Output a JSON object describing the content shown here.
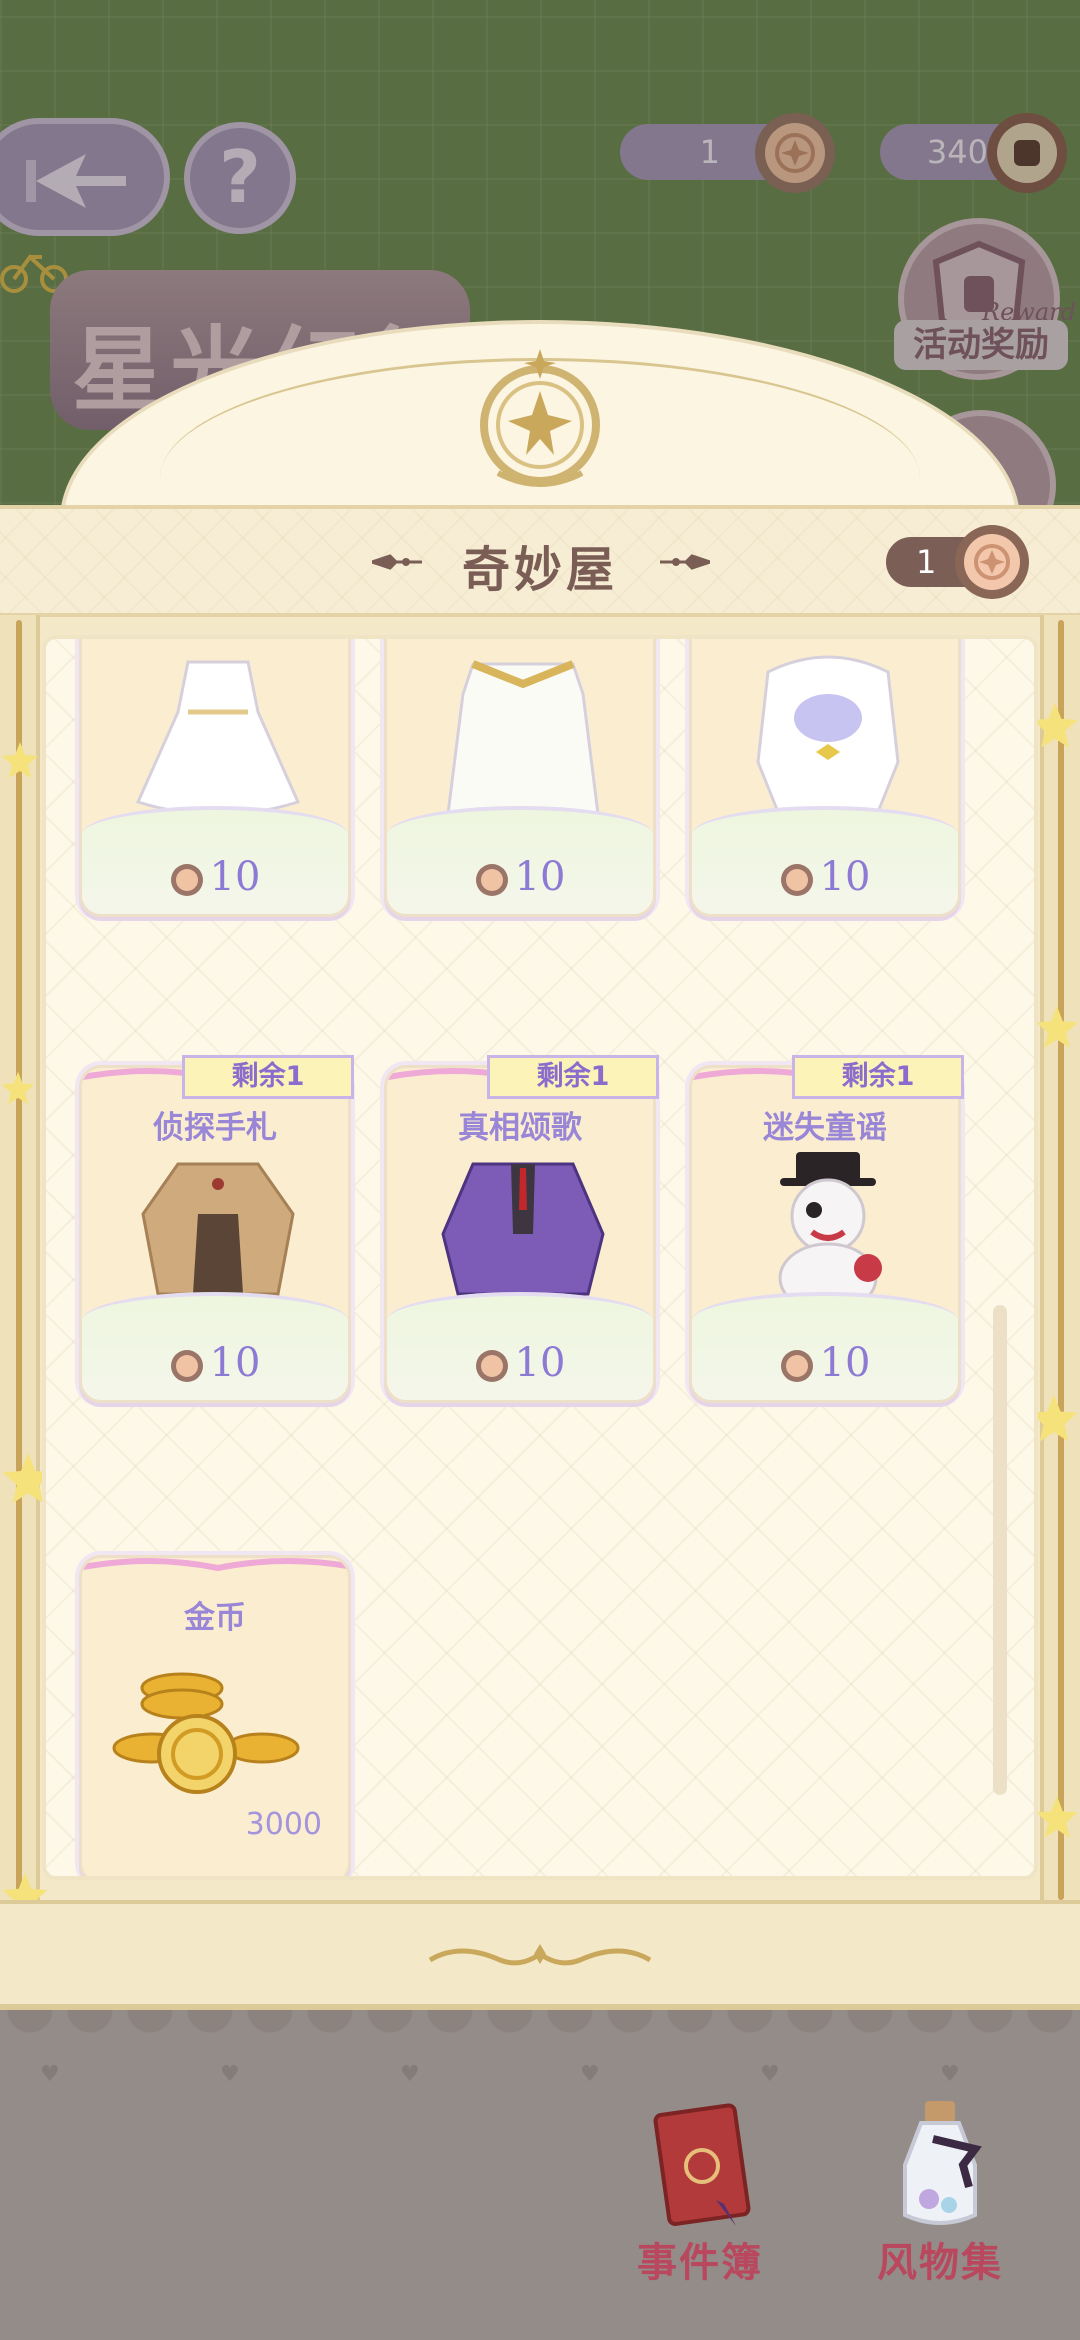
{
  "header": {
    "currency_event": {
      "value": "1",
      "icon": "event-token-coin-icon"
    },
    "currency_badge": {
      "value": "340",
      "icon": "badge-medal-icon"
    },
    "help_glyph": "?",
    "event_title": "星光幻行",
    "reward_button": {
      "label": "活动奖励",
      "script": "Reward"
    }
  },
  "shop": {
    "title": "奇妙屋",
    "balance": "1",
    "items": [
      {
        "name": "",
        "price": "10",
        "remaining": "",
        "art": "white-dress-icon"
      },
      {
        "name": "",
        "price": "10",
        "remaining": "",
        "art": "white-gown-icon"
      },
      {
        "name": "",
        "price": "10",
        "remaining": "",
        "art": "white-hood-outfit-icon"
      },
      {
        "name": "侦探手札",
        "price": "10",
        "remaining": "剩余1",
        "art": "trench-coat-outfit-icon"
      },
      {
        "name": "真相颂歌",
        "price": "10",
        "remaining": "剩余1",
        "art": "purple-suit-outfit-icon"
      },
      {
        "name": "迷失童谣",
        "price": "10",
        "remaining": "剩余1",
        "art": "bear-plush-icon"
      },
      {
        "name": "金币",
        "price": "",
        "remaining": "",
        "quantity": "3000",
        "art": "gold-coins-icon"
      }
    ]
  },
  "nav": {
    "items": [
      {
        "label": "事件簿",
        "icon": "red-book-icon"
      },
      {
        "label": "风物集",
        "icon": "bottle-icon"
      }
    ]
  },
  "colors": {
    "accent_purple": "#8d7ad4",
    "title_brown": "#7a5e56",
    "nav_label_red": "#b9475e",
    "panel_cream": "#fdf8e8"
  }
}
